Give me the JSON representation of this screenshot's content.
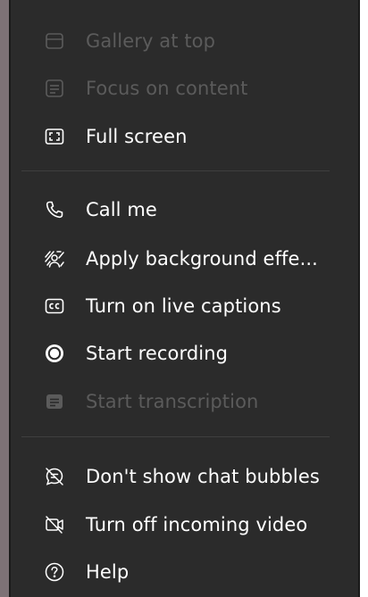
{
  "menu": {
    "items": [
      {
        "label": "Gallery at top",
        "icon": "gallery-top-icon",
        "enabled": false
      },
      {
        "label": "Focus on content",
        "icon": "focus-content-icon",
        "enabled": false
      },
      {
        "label": "Full screen",
        "icon": "full-screen-icon",
        "enabled": true
      },
      {
        "label": "Call me",
        "icon": "phone-icon",
        "enabled": true
      },
      {
        "label": "Apply background effe...",
        "icon": "background-effects-icon",
        "enabled": true
      },
      {
        "label": "Turn on live captions",
        "icon": "closed-captions-icon",
        "enabled": true
      },
      {
        "label": "Start recording",
        "icon": "record-icon",
        "enabled": true
      },
      {
        "label": "Start transcription",
        "icon": "transcription-icon",
        "enabled": false
      },
      {
        "label": "Don't show chat bubbles",
        "icon": "chat-bubbles-off-icon",
        "enabled": true
      },
      {
        "label": "Turn off incoming video",
        "icon": "video-off-icon",
        "enabled": true
      },
      {
        "label": "Help",
        "icon": "help-icon",
        "enabled": true
      }
    ]
  },
  "colors": {
    "menu_background": "#2b2b2b",
    "text_enabled": "#ffffff",
    "text_disabled": "#5b5b5b",
    "divider": "#3f3f3f"
  }
}
